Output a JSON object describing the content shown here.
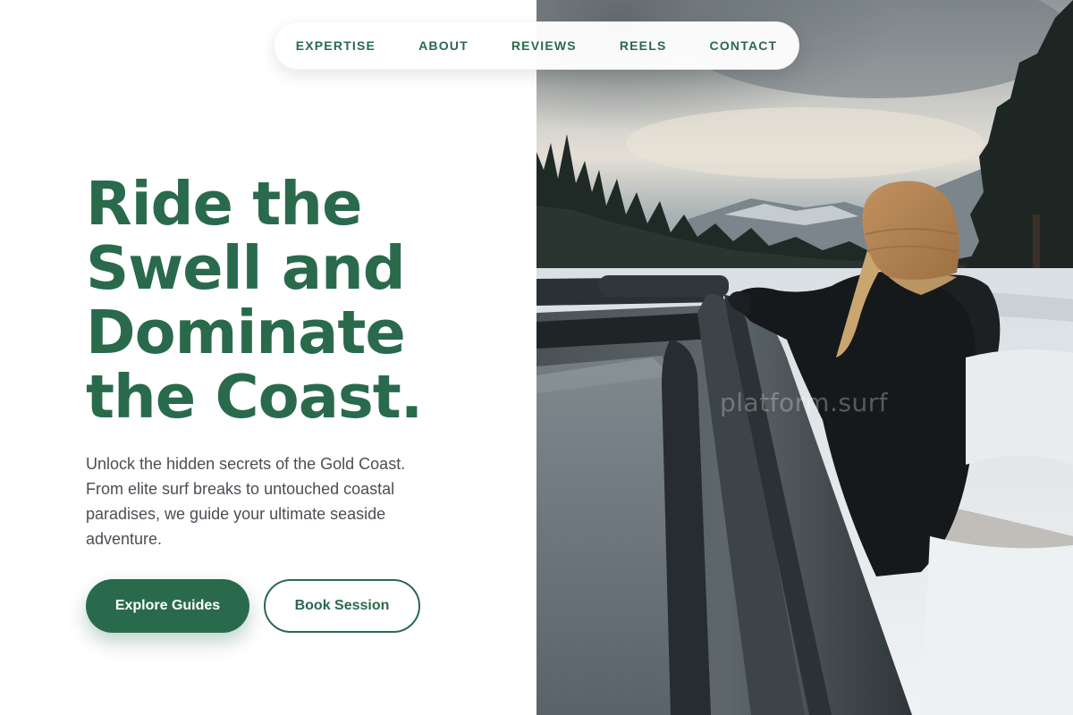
{
  "nav": {
    "links": [
      "EXPERTISE",
      "ABOUT",
      "REVIEWS",
      "REELS",
      "CONTACT"
    ]
  },
  "hero": {
    "headline_lines": [
      "Ride the",
      "Swell and",
      "Dominate",
      "the Coast."
    ],
    "description": "Unlock the hidden secrets of the Gold Coast. From elite surf breaks to untouched coastal paradises, we guide your ultimate seaside adventure.",
    "primary_button": "Explore Guides",
    "secondary_button": "Book Session"
  },
  "photo": {
    "watermark": "platform.surf",
    "alt": "Person in a tan beanie and black jacket leaning on a car roof rack in a snowy mountain forest"
  },
  "colors": {
    "brand_green": "#2a6a4c",
    "body_text": "#4a4f55",
    "background": "#ffffff"
  }
}
